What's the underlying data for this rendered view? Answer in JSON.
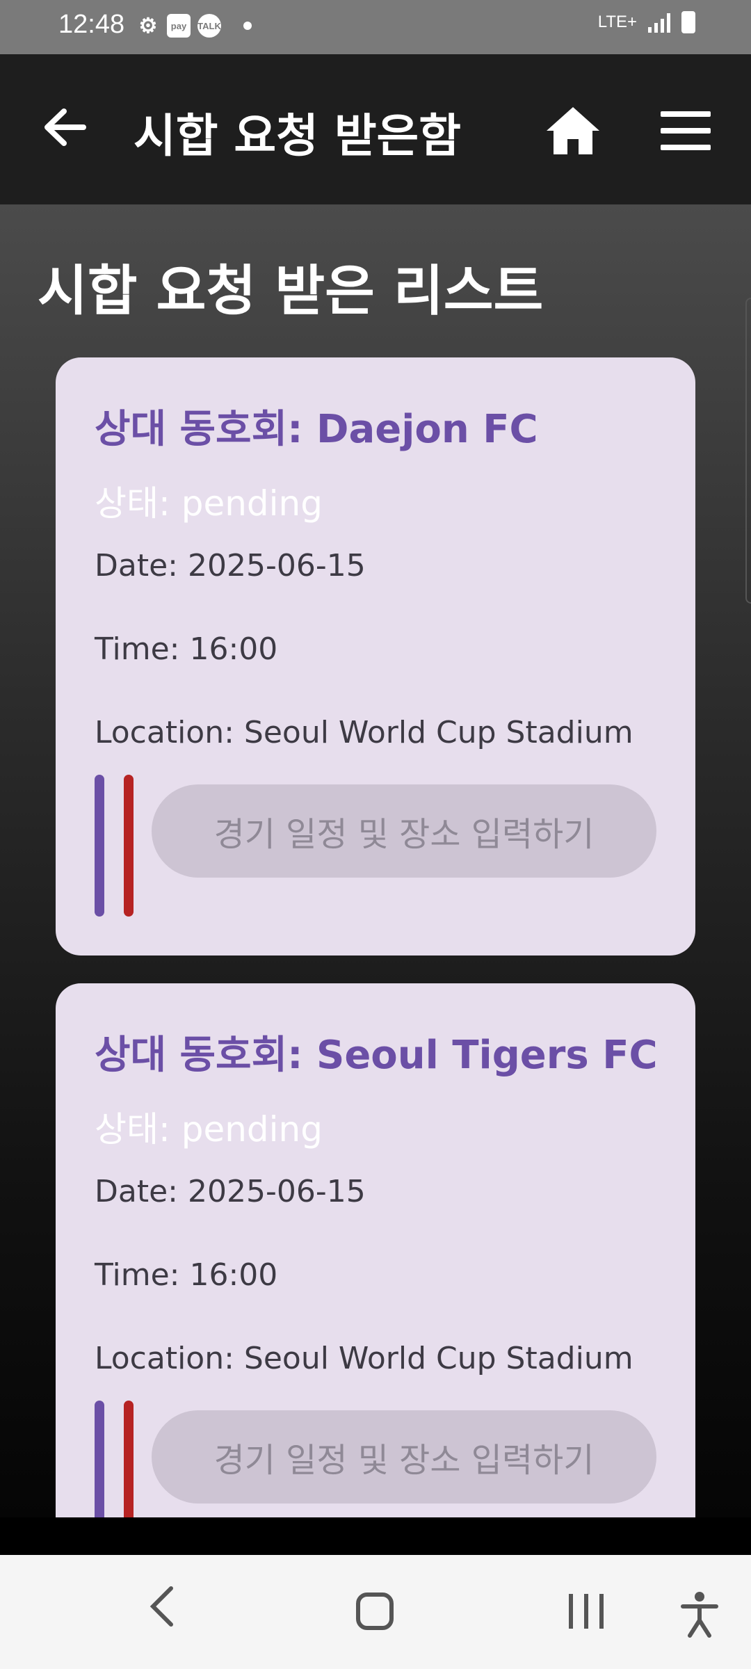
{
  "status_bar": {
    "time": "12:48",
    "icons": [
      "settings-icon",
      "pay-icon",
      "talk-icon",
      "notification-dot"
    ],
    "pay_label": "pay",
    "talk_label": "TALK",
    "network": "LTE+"
  },
  "app_bar": {
    "title": "시합 요청 받은함",
    "back_icon": "back-arrow-icon",
    "home_icon": "home-icon",
    "menu_icon": "menu-icon"
  },
  "page": {
    "heading": "시합 요청 받은 리스트"
  },
  "requests": [
    {
      "title": "상대 동호회: Daejon FC",
      "status": "상태: pending",
      "date": "Date: 2025-06-15",
      "time": "Time: 16:00",
      "location": "Location: Seoul World Cup Stadium",
      "button": "경기 일정 및 장소 입력하기"
    },
    {
      "title": "상대 동호회: Seoul Tigers FC",
      "status": "상태: pending",
      "date": "Date: 2025-06-15",
      "time": "Time: 16:00",
      "location": "Location: Seoul World Cup Stadium",
      "button": "경기 일정 및 장소 입력하기"
    }
  ],
  "colors": {
    "accent": "#6b4fa6",
    "card_bg": "#e7deed",
    "red_bar": "#b62323",
    "button_bg": "#cdc4d3"
  }
}
